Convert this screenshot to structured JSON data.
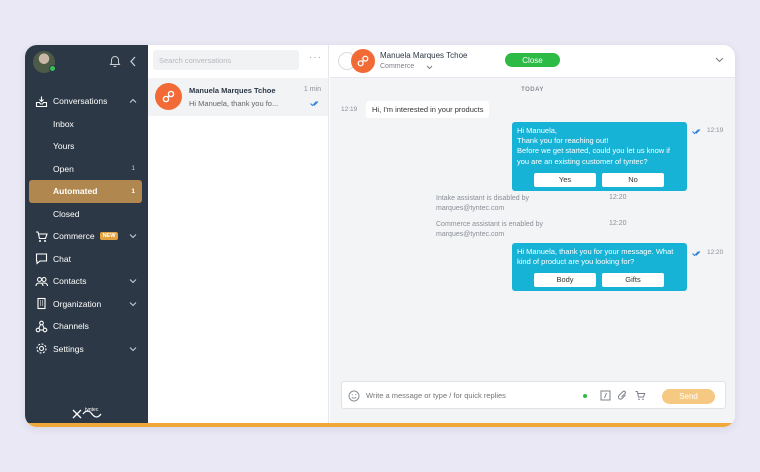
{
  "sidebar": {
    "nav": [
      {
        "label": "Conversations",
        "icon": "inbox-tray-icon",
        "expanded": true
      },
      {
        "label": "Commerce",
        "icon": "cart-icon",
        "badge": "NEW"
      },
      {
        "label": "Chat",
        "icon": "chat-icon"
      },
      {
        "label": "Contacts",
        "icon": "contacts-icon"
      },
      {
        "label": "Organization",
        "icon": "building-icon"
      },
      {
        "label": "Channels",
        "icon": "channels-icon"
      },
      {
        "label": "Settings",
        "icon": "gear-icon"
      }
    ],
    "conversations_sub": [
      {
        "label": "Inbox",
        "count": ""
      },
      {
        "label": "Yours",
        "count": ""
      },
      {
        "label": "Open",
        "count": "1"
      },
      {
        "label": "Automated",
        "count": "1"
      },
      {
        "label": "Closed",
        "count": ""
      }
    ],
    "logo_text": "tyntec",
    "active_color": "#b0884f"
  },
  "conversation_list": {
    "search_placeholder": "Search conversations",
    "more_label": "···",
    "items": [
      {
        "name": "Manuela Marques Tchoe",
        "time": "1 min",
        "preview": "Hi Manuela, thank you fo..."
      }
    ]
  },
  "chat": {
    "contact_name": "Manuela Marques Tchoe",
    "channel": "Commerce",
    "close_label": "Close",
    "day_label": "TODAY",
    "messages": [
      {
        "time": "12:19",
        "text": "Hi, I'm interested in your products"
      },
      {
        "time": "12:19",
        "lines": [
          "Hi Manuela,",
          "Thank you for reaching out!",
          "Before we get started, could you let us know if",
          "you are an existing customer of tyntec?"
        ],
        "buttons": [
          "Yes",
          "No"
        ]
      },
      {
        "time": "12:20",
        "lines": [
          "Intake assistant is disabled by",
          "marques@tyntec.com"
        ]
      },
      {
        "time": "12:20",
        "lines": [
          "Commerce assistant is enabled by",
          "marques@tyntec.com"
        ]
      },
      {
        "time": "12:20",
        "lines": [
          "Hi Manuela, thank you for your message. What",
          "kind of product are you looking for?"
        ],
        "buttons": [
          "Body",
          "Gifts"
        ]
      }
    ],
    "composer_placeholder": "Write a message or type / for quick replies",
    "send_label": "Send"
  },
  "colors": {
    "sidebar_bg": "#2d3846",
    "accent_blue": "#17b3d6",
    "close_green": "#2dbb45",
    "avatar_orange": "#f26a35",
    "send_button": "#f6c982"
  }
}
